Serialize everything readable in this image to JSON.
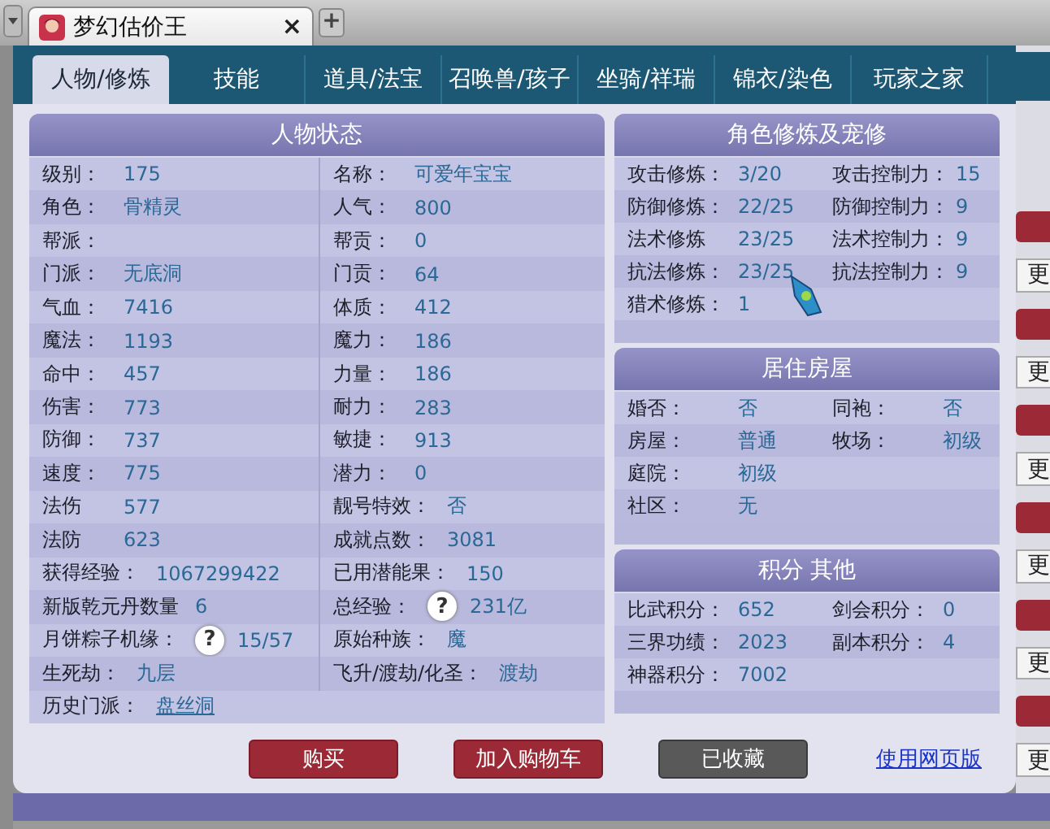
{
  "browser_tab": {
    "title": "梦幻估价王",
    "close": "×",
    "new_tab": "+"
  },
  "tabs": [
    {
      "label": "人物/修炼",
      "selected": true
    },
    {
      "label": "技能",
      "selected": false
    },
    {
      "label": "道具/法宝",
      "selected": false
    },
    {
      "label": "召唤兽/孩子",
      "selected": false
    },
    {
      "label": "坐骑/祥瑞",
      "selected": false
    },
    {
      "label": "锦衣/染色",
      "selected": false
    },
    {
      "label": "玩家之家",
      "selected": false
    }
  ],
  "left_panel": {
    "title": "人物状态",
    "rows": [
      [
        {
          "label": "级别：",
          "value": "175"
        },
        {
          "label": "名称：",
          "value": "可爱年宝宝"
        }
      ],
      [
        {
          "label": "角色：",
          "value": "骨精灵"
        },
        {
          "label": "人气：",
          "value": "800"
        }
      ],
      [
        {
          "label": "帮派："
        },
        {
          "label": "帮贡：",
          "value": "0"
        }
      ],
      [
        {
          "label": "门派：",
          "value": "无底洞"
        },
        {
          "label": "门贡：",
          "value": "64"
        }
      ],
      [
        {
          "label": "气血：",
          "value": "7416"
        },
        {
          "label": "体质：",
          "value": "412"
        }
      ],
      [
        {
          "label": "魔法：",
          "value": "1193"
        },
        {
          "label": "魔力：",
          "value": "186"
        }
      ],
      [
        {
          "label": "命中：",
          "value": "457"
        },
        {
          "label": "力量：",
          "value": "186"
        }
      ],
      [
        {
          "label": "伤害：",
          "value": "773"
        },
        {
          "label": "耐力：",
          "value": "283"
        }
      ],
      [
        {
          "label": "防御：",
          "value": "737"
        },
        {
          "label": "敏捷：",
          "value": "913"
        }
      ],
      [
        {
          "label": "速度：",
          "value": "775"
        },
        {
          "label": "潜力：",
          "value": "0"
        }
      ],
      [
        {
          "label": "法伤",
          "value": "577"
        },
        {
          "label": "靓号特效：",
          "value": "否"
        }
      ],
      [
        {
          "label": "法防",
          "value": "623"
        },
        {
          "label": "成就点数：",
          "value": "3081"
        }
      ],
      [
        {
          "label": "获得经验：",
          "value": "1067299422"
        },
        {
          "label": "已用潜能果：",
          "value": "150"
        }
      ],
      [
        {
          "label": "新版乾元丹数量",
          "value": "6"
        },
        {
          "label": "总经验：",
          "value": "231亿",
          "help": "?"
        }
      ],
      [
        {
          "label": "月饼粽子机缘：",
          "value": "15/57",
          "help": "?"
        },
        {
          "label": "原始种族：",
          "value": "魔"
        }
      ],
      [
        {
          "label": "生死劫：",
          "value": "九层"
        },
        {
          "label": "飞升/渡劫/化圣：",
          "value": "渡劫"
        }
      ],
      [
        {
          "label": "历史门派：",
          "value": "盘丝洞",
          "link": true
        }
      ]
    ]
  },
  "right_panels": [
    {
      "title": "角色修炼及宠修",
      "rows": [
        [
          {
            "label": "攻击修炼：",
            "value": "3/20"
          },
          {
            "label": "攻击控制力：",
            "value": "15"
          }
        ],
        [
          {
            "label": "防御修炼：",
            "value": "22/25"
          },
          {
            "label": "防御控制力：",
            "value": "9"
          }
        ],
        [
          {
            "label": "法术修炼",
            "value": "23/25"
          },
          {
            "label": "法术控制力：",
            "value": "9"
          }
        ],
        [
          {
            "label": "抗法修炼：",
            "value": "23/25"
          },
          {
            "label": "抗法控制力：",
            "value": "9"
          }
        ],
        [
          {
            "label": "猎术修炼：",
            "value": "1"
          }
        ]
      ]
    },
    {
      "title": "居住房屋",
      "rows": [
        [
          {
            "label": "婚否：",
            "value": "否"
          },
          {
            "label": "同袍：",
            "value": "否"
          }
        ],
        [
          {
            "label": "房屋：",
            "value": "普通"
          },
          {
            "label": "牧场：",
            "value": "初级"
          }
        ],
        [
          {
            "label": "庭院：",
            "value": "初级"
          }
        ],
        [
          {
            "label": "社区：",
            "value": "无"
          }
        ]
      ]
    },
    {
      "title": "积分 其他",
      "rows": [
        [
          {
            "label": "比武积分：",
            "value": "652"
          },
          {
            "label": "剑会积分：",
            "value": "0"
          }
        ],
        [
          {
            "label": "三界功绩：",
            "value": "2023"
          },
          {
            "label": "副本积分：",
            "value": "4"
          }
        ],
        [
          {
            "label": "神器积分：",
            "value": "7002"
          }
        ]
      ]
    }
  ],
  "actions": [
    {
      "kind": "primary",
      "label": "购买"
    },
    {
      "kind": "primary",
      "label": "加入购物车"
    },
    {
      "kind": "muted",
      "label": "已收藏"
    },
    {
      "kind": "link",
      "label": "使用网页版"
    }
  ],
  "side_buttons": [
    {
      "kind": "buy"
    },
    {
      "kind": "more",
      "label": "更"
    },
    {
      "kind": "buy"
    },
    {
      "kind": "more",
      "label": "更"
    },
    {
      "kind": "buy"
    },
    {
      "kind": "more",
      "label": "更"
    },
    {
      "kind": "buy"
    },
    {
      "kind": "more",
      "label": "更"
    },
    {
      "kind": "buy"
    },
    {
      "kind": "more",
      "label": "更"
    },
    {
      "kind": "buy"
    },
    {
      "kind": "more",
      "label": "更"
    }
  ]
}
